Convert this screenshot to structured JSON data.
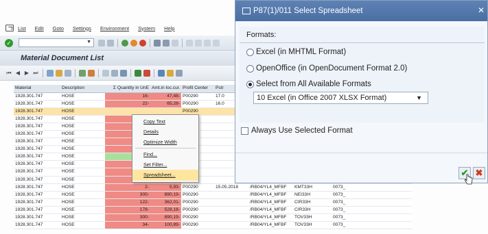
{
  "menubar": {
    "items": [
      "List",
      "Edit",
      "Goto",
      "Settings",
      "Environment",
      "System",
      "Help"
    ]
  },
  "page": {
    "title": "Material Document List"
  },
  "grid": {
    "columns": [
      "Material",
      "Description",
      "Σ Quantity in UnE",
      "Amt.in loc.cur.",
      "Profit Center",
      "Pstr",
      "",
      "",
      ""
    ],
    "rows": [
      {
        "material": "1928.301.747",
        "description": "HOSE",
        "qty": "16-",
        "amount": "47,48-",
        "profit_center": "P00290",
        "date": "17.0",
        "movement": "",
        "doc": "",
        "extra": ""
      },
      {
        "material": "1928.301.747",
        "description": "HOSE",
        "qty": "22-",
        "amount": "65,28-",
        "profit_center": "P00290",
        "date": "16.0",
        "movement": "",
        "doc": "",
        "extra": ""
      },
      {
        "material": "1928.301.747",
        "description": "HOSE",
        "qty": "",
        "amount": "",
        "profit_center": "P00290",
        "date": "",
        "movement": "",
        "doc": "",
        "extra": ""
      },
      {
        "material": "1928.301.747",
        "description": "HOSE",
        "qty": "",
        "amount": "",
        "profit_center": "P00290",
        "date": "",
        "movement": "",
        "doc": "",
        "extra": ""
      },
      {
        "material": "1928.301.747",
        "description": "HOSE",
        "qty": "",
        "amount": "",
        "profit_center": "P00290",
        "date": "",
        "movement": "",
        "doc": "",
        "extra": ""
      },
      {
        "material": "1928.301.747",
        "description": "HOSE",
        "qty": "",
        "amount": "",
        "profit_center": "P00290",
        "date": "",
        "movement": "",
        "doc": "",
        "extra": ""
      },
      {
        "material": "1928.301.747",
        "description": "HOSE",
        "qty": "",
        "amount": "",
        "profit_center": "P00290",
        "date": "",
        "movement": "",
        "doc": "",
        "extra": ""
      },
      {
        "material": "1928.301.747",
        "description": "HOSE",
        "qty": "",
        "amount": "",
        "profit_center": "P00290",
        "date": "",
        "movement": "",
        "doc": "",
        "extra": ""
      },
      {
        "material": "1928.301.747",
        "description": "HOSE",
        "qty": "",
        "amount": "",
        "profit_center": "P00290",
        "date": "",
        "movement": "",
        "doc": "",
        "extra": ""
      },
      {
        "material": "1928.301.747",
        "description": "HOSE",
        "qty": "",
        "amount": "",
        "profit_center": "P00290",
        "date": "",
        "movement": "",
        "doc": "",
        "extra": ""
      },
      {
        "material": "1928.301.747",
        "description": "HOSE",
        "qty": "",
        "amount": "",
        "profit_center": "P00290",
        "date": "",
        "movement": "",
        "doc": "",
        "extra": ""
      },
      {
        "material": "1928.301.747",
        "description": "HOSE",
        "qty": "300-",
        "amount": "890,19-",
        "profit_center": "P00290",
        "date": "",
        "movement": "",
        "doc": "",
        "extra": ""
      },
      {
        "material": "1928.301.747",
        "description": "HOSE",
        "qty": "2-",
        "amount": "5,93-",
        "profit_center": "P00290",
        "date": "15.05.2018",
        "movement": "/RB04/YL4_MFBF",
        "doc": "KMT33H",
        "extra": "0073_"
      },
      {
        "material": "1928.301.747",
        "description": "HOSE",
        "qty": "300-",
        "amount": "890,19-",
        "profit_center": "P00290",
        "date": "",
        "movement": "/RB04/YL4_MFBF",
        "doc": "NEI33H",
        "extra": "0073_"
      },
      {
        "material": "1928.301.747",
        "description": "HOSE",
        "qty": "122-",
        "amount": "362,01-",
        "profit_center": "P00290",
        "date": "",
        "movement": "/RB04/YL4_MFBF",
        "doc": "CIR33H",
        "extra": "0073_"
      },
      {
        "material": "1928.301.747",
        "description": "HOSE",
        "qty": "178-",
        "amount": "528,18-",
        "profit_center": "P00290",
        "date": "",
        "movement": "/RB04/YL4_MFBF",
        "doc": "CIR33H",
        "extra": "0073_"
      },
      {
        "material": "1928.301.747",
        "description": "HOSE",
        "qty": "300-",
        "amount": "890,19-",
        "profit_center": "P00290",
        "date": "",
        "movement": "/RB04/YL4_MFBF",
        "doc": "TOV33H",
        "extra": "0073_"
      },
      {
        "material": "1928.301.747",
        "description": "HOSE",
        "qty": "34-",
        "amount": "100,89-",
        "profit_center": "P00290",
        "date": "",
        "movement": "/RB04/YL4_MFBF",
        "doc": "TOV33H",
        "extra": "0073_"
      }
    ]
  },
  "context_menu": {
    "items": [
      "Copy Text",
      "Details",
      "Optimize Width",
      "Find...",
      "Set Filter...",
      "Spreadsheet..."
    ]
  },
  "dialog": {
    "title": "P87(1)/011 Select Spreadsheet",
    "group_label": "Formats:",
    "options": [
      "Excel (in MHTML Format)",
      "OpenOffice (in OpenDocument Format 2.0)",
      "Select from All Available Formats"
    ],
    "selected_format": "10 Excel (in Office 2007 XLSX Format)",
    "checkbox_label": "Always Use Selected Format"
  },
  "colors": {
    "negative_cell": "#f08a84",
    "selected_row": "#fde3a7",
    "dialog_title": "#4a6fa3"
  }
}
